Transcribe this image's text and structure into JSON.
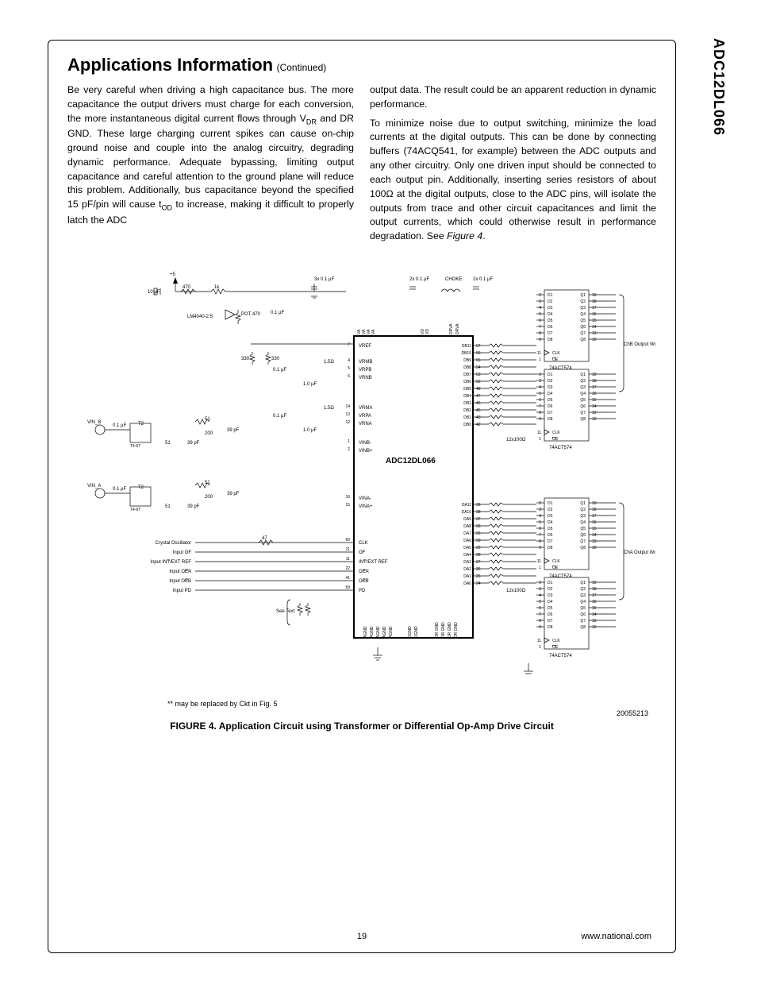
{
  "part_number": "ADC12DL066",
  "section_title": "Applications Information",
  "continued": "(Continued)",
  "col1": {
    "p1a": "Be very careful when driving a high capacitance bus. The more capacitance the output drivers must charge for each conversion, the more instantaneous digital current flows through V",
    "p1sub1": "DR",
    "p1b": " and DR GND. These large charging current spikes can cause on-chip ground noise and couple into the analog circuitry, degrading dynamic performance. Adequate bypassing, limiting output capacitance and careful attention to the ground plane will reduce this problem. Additionally, bus capacitance beyond the specified 15 pF/pin will cause t",
    "p1sub2": "OD",
    "p1c": " to increase, making it difficult to properly latch the ADC"
  },
  "col2": {
    "p1": "output data. The result could be an apparent reduction in dynamic performance.",
    "p2a": "To minimize noise due to output switching, minimize the load currents at the digital outputs. This can be done by connecting buffers (74ACQ541, for example) between the ADC outputs and any other circuitry. Only one driven input should be connected to each output pin. Additionally, inserting series resistors of about 100Ω at the digital outputs, close to the ADC pins, will isolate the outputs from trace and other circuit capacitances and limit the output currents, which could otherwise result in performance degradation. See ",
    "p2ref": "Figure 4",
    "p2b": "."
  },
  "figure": {
    "caption": "FIGURE 4. Application Circuit using Transformer or Differential Op-Amp Drive Circuit",
    "drawing_number": "20055213",
    "footnote": "** may be replaced by Ckt in Fig. 5",
    "labels": {
      "plus5": "+5",
      "cap_3x": "3x 0.1 µF",
      "cap_2x_a": "2x 0.1 µF",
      "choke": "CHOKE",
      "cap_2x_b": "2x 0.1 µF",
      "r470a": "470",
      "r1k": "1k",
      "c10u": "10 µF",
      "lm4040": "LM4040-2.5",
      "pot": "POT 470",
      "c01a": "0.1 µF",
      "r330a": "330",
      "r330b": "330",
      "c01b": "0.1 µF",
      "r1p5a": "1.5Ω",
      "r1p5b": "1.5Ω",
      "c1u_a": "1.0 µF",
      "c1u_b": "1.0 µF",
      "r51a": "51",
      "r51b": "51",
      "r51c": "51",
      "r51d": "51",
      "r200a": "200",
      "r200b": "200",
      "c39a": "39 pF",
      "c39b": "39 pF",
      "c39c": "39 pF",
      "c39d": "39 pF",
      "t2a": "T2",
      "t2b": "T2",
      "t46a": "T4-6T",
      "t46b": "T4-6T",
      "vinb": "VIN_B",
      "vina": "VIN_A",
      "r47": "47",
      "crystal": "Crystal Oscillator",
      "input_of": "Input OF",
      "input_intext": "Input INT/EXT REF",
      "input_oea": "Input OEA",
      "input_oeb": "Input OEB",
      "input_pd": "Input PD",
      "see_text": "See Text",
      "vref": "VREF",
      "vrmb": "VRMB",
      "vrpb": "VRPB",
      "vrnb": "VRNB",
      "vrma": "VRMA",
      "vrpa": "VRPA",
      "vrna": "VRNA",
      "vinbm": "VINB-",
      "vinbp": "VINB+",
      "vinam": "VINA-",
      "vinap": "VINA+",
      "clk": "CLK",
      "of": "OF",
      "intext": "INT/EXT REF",
      "oea": "OEA",
      "oeb": "OEB",
      "pd": "PD",
      "agnd": "AGND",
      "drgnd": "DR GND",
      "dgnd": "DGND",
      "vd": "VD",
      "va": "VA",
      "drva": "DRVA",
      "chip": "ADC12DL066",
      "r12x100": "12x100Ω",
      "latch": "74ACT574",
      "chb": "ChB Output Word",
      "cha": "ChA Output Word",
      "oe_bar": "OE"
    },
    "db_pins": [
      "DB11",
      "DB10",
      "DB9",
      "DB8",
      "DB7",
      "DB6",
      "DB5",
      "DB4",
      "DB3",
      "DB2",
      "DB1",
      "DB0"
    ],
    "db_nums": [
      "57",
      "56",
      "55",
      "54",
      "53",
      "52",
      "48",
      "47",
      "46",
      "45",
      "43",
      "42"
    ],
    "da_pins": [
      "DA11",
      "DA10",
      "DA9",
      "DA8",
      "DA7",
      "DA6",
      "DA5",
      "DA4",
      "DA3",
      "DA2",
      "DA1",
      "DA0"
    ],
    "da_nums": [
      "39",
      "38",
      "37",
      "36",
      "35",
      "30",
      "29",
      "28",
      "27",
      "26",
      "25",
      "24"
    ],
    "d_left": [
      "D1",
      "D2",
      "D3",
      "D4",
      "D5",
      "D6",
      "D7",
      "D8"
    ],
    "d_left_nums": [
      "2",
      "3",
      "4",
      "5",
      "6",
      "7",
      "8",
      "9"
    ],
    "q_right": [
      "Q1",
      "Q2",
      "Q3",
      "Q4",
      "Q5",
      "Q6",
      "Q7",
      "Q8"
    ],
    "q_right_nums": [
      "19",
      "18",
      "17",
      "16",
      "15",
      "14",
      "13",
      "12"
    ],
    "latch_clk_num": "11",
    "latch_oe_num": "1",
    "pin7": "7",
    "pin4": "4",
    "pin5": "5",
    "pin6": "6",
    "pin14": "14",
    "pin13": "13",
    "pin12": "12",
    "pin1": "1",
    "pin2": "2",
    "pin16": "16",
    "pin15": "15",
    "pin60": "60",
    "pin21": "21",
    "pin11": "11",
    "pin22": "22",
    "pin41": "41",
    "pin59": "59",
    "stars": "**"
  },
  "footer": {
    "page": "19",
    "url": "www.national.com"
  }
}
